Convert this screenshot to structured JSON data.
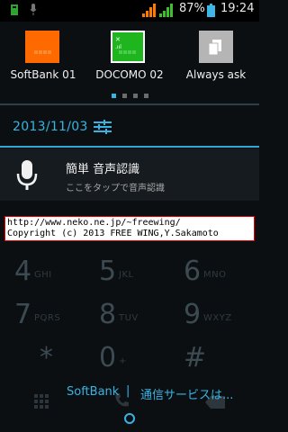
{
  "status_bar": {
    "icons": [
      "notification-icon",
      "microphone-icon",
      "signal-bars-icon",
      "signal-bars-icon",
      "wifi-icon",
      "battery-icon"
    ],
    "battery": "87%",
    "time": "19:24"
  },
  "sim_selector": {
    "items": [
      {
        "label": "SoftBank 01",
        "color": "#ff6a00"
      },
      {
        "label": "DOCOMO 02",
        "color": "#1fb51f"
      },
      {
        "label": "Always ask",
        "color": "#b5b5b5"
      }
    ],
    "page_count": 4,
    "active_page": 1
  },
  "date": "2013/11/03",
  "notification": {
    "title": "簡単 音声認識",
    "subtitle": "ここをタップで音声認識"
  },
  "watermark": {
    "line1": "http://www.neko.ne.jp/~freewing/",
    "line2": "Copyright (c) 2013 FREE WING,Y.Sakamoto"
  },
  "dialer": {
    "keys": [
      {
        "digit": "4",
        "letters": "GHI"
      },
      {
        "digit": "5",
        "letters": "JKL"
      },
      {
        "digit": "6",
        "letters": "MNO"
      },
      {
        "digit": "7",
        "letters": "PQRS"
      },
      {
        "digit": "8",
        "letters": "TUV"
      },
      {
        "digit": "9",
        "letters": "WXYZ"
      },
      {
        "digit": "*",
        "letters": ""
      },
      {
        "digit": "0",
        "letters": "+"
      },
      {
        "digit": "#",
        "letters": ""
      }
    ]
  },
  "carrier": {
    "left": "SoftBank",
    "separator": "|",
    "right": "通信サービスは..."
  },
  "colors": {
    "accent": "#33b5e5"
  }
}
